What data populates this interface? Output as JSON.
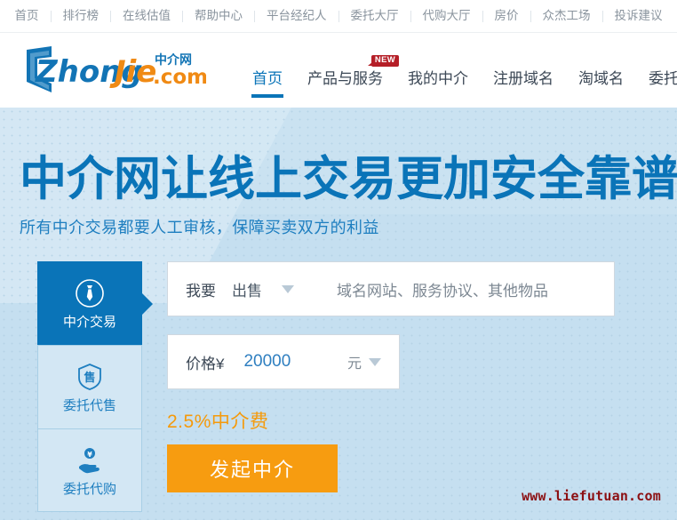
{
  "topnav": {
    "items": [
      {
        "label": "首页"
      },
      {
        "label": "排行榜"
      },
      {
        "label": "在线估值"
      },
      {
        "label": "帮助中心"
      },
      {
        "label": "平台经纪人"
      },
      {
        "label": "委托大厅"
      },
      {
        "label": "代购大厅"
      },
      {
        "label": "房价"
      },
      {
        "label": "众杰工场"
      },
      {
        "label": "投诉建议"
      }
    ]
  },
  "logo": {
    "wordmark": "ZhongJie",
    "tld": ".com",
    "cn_name": "中介网",
    "shield_icon": "shield-icon",
    "blue": "#1274b5",
    "orange": "#f08a14"
  },
  "mainnav": {
    "items": [
      {
        "label": "首页",
        "active": true,
        "badge": ""
      },
      {
        "label": "产品与服务",
        "active": false,
        "badge": "NEW"
      },
      {
        "label": "我的中介",
        "active": false,
        "badge": ""
      },
      {
        "label": "注册域名",
        "active": false,
        "badge": ""
      },
      {
        "label": "淘域名",
        "active": false,
        "badge": ""
      },
      {
        "label": "委托大厅",
        "active": false,
        "badge": ""
      }
    ],
    "accent": "#0a74b8",
    "badge_color": "#b51e27"
  },
  "hero": {
    "title": "中介网让线上交易更加安全靠谱",
    "subtitle": "所有中介交易都要人工审核，保障买卖双方的利益",
    "title_color": "#0a74b8",
    "bg_color": "#c5dff0"
  },
  "widget": {
    "tabs": [
      {
        "label": "中介交易",
        "icon": "necktie-icon",
        "active": true
      },
      {
        "label": "委托代售",
        "icon": "shield-sale-icon",
        "active": false
      },
      {
        "label": "委托代购",
        "icon": "hand-coin-icon",
        "active": false
      }
    ],
    "trade_row": {
      "label": "我要",
      "selected": "出售",
      "caret_icon": "chevron-down-icon",
      "placeholder": "域名网站、服务协议、其他物品"
    },
    "price_row": {
      "label": "价格¥",
      "value": "20000",
      "unit": "元",
      "caret_icon": "chevron-down-icon"
    },
    "fee_note": "2.5%中介费",
    "cta_label": "发起中介",
    "cta_color": "#f79c10"
  },
  "watermark": {
    "text": "www.liefutuan.com",
    "color": "#8c1013"
  }
}
